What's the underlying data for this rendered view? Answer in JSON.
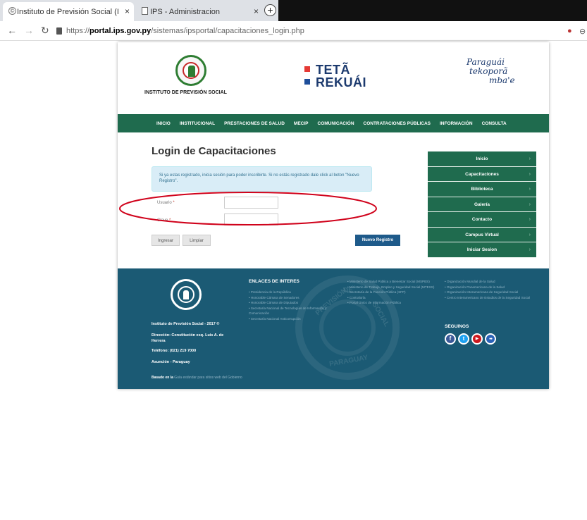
{
  "browser": {
    "tabs": [
      {
        "title": "Instituto de Previsión Social (IPS)",
        "active": true
      },
      {
        "title": "IPS - Administracion",
        "active": false
      }
    ],
    "new_tab": "+",
    "close": "×",
    "url_scheme": "https://",
    "url_host": "portal.ips.gov.py",
    "url_path": "/sistemas/ipsportal/capacitaciones_login.php"
  },
  "header": {
    "logo_text": "INSTITUTO DE PREVISIÓN SOCIAL",
    "teta_line1": "TETÃ",
    "teta_line2": "REKUÁI",
    "slogan": [
      "Paraguái",
      "tekoporã",
      "mba'e"
    ]
  },
  "nav": [
    "INICIO",
    "INSTITUCIONAL",
    "PRESTACIONES DE SALUD",
    "MECIP",
    "COMUNICACIÓN",
    "CONTRATACIONES PÚBLICAS",
    "INFORMACIÓN",
    "CONSULTA"
  ],
  "login": {
    "title": "Login de Capacitaciones",
    "info": "Si ya estas registrado, inicia sesión para poder inscribirte. Si no estás registrado dale click al boton \"Nuevo Registro\".",
    "user_label": "Usuario",
    "pass_label": "Clave",
    "required_mark": " *",
    "user_value": "",
    "pass_value": "",
    "btn_ingresar": "Ingresar",
    "btn_limpiar": "Limpiar",
    "btn_nuevo": "Nuevo Registro"
  },
  "side_menu": [
    "Inicio",
    "Capacitaciones",
    "Biblioteca",
    "Galería",
    "Contacto",
    "Campus Virtual",
    "Iniciar Sesion"
  ],
  "footer": {
    "copyright": "Instituto de Previsión Social - 2017 ©",
    "address": "Dirección: Constitución esq. Luis A. de Herrera",
    "phone": "Teléfono: (021) 219 7000",
    "city": "Asunción - Paraguay",
    "based_label": "Basado en la",
    "based_text": "Guía estándar para sitios web del Gobierno",
    "enlaces_title": "ENLACES DE INTERES",
    "links_col1": [
      "• Presidencia de la República",
      "• Honorable Cámara de Senadores",
      "• Honorable Cámara de Diputados",
      "• Secretaría Nacional de Tecnologías de Información y Comunicación",
      "• Secretaría Nacional Anticorrupción"
    ],
    "links_col2": [
      "• Ministerio de Salud Pública y Bienestar Social (MSPBS)",
      "• Ministerio de Trabajo, Empleo y Seguridad Social (MTESS)",
      "• Secretaría de la Función Pública (SFP)",
      "• Contraloría",
      "• Portal Único de Información Pública"
    ],
    "links_col3": [
      "• Organización Mundial de la Salud",
      "• Organización Panamericana de la Salud",
      "• Organización Interamericana de Seguridad Social",
      "• Centro Interamericano de Estudios de la Seguridad Social"
    ],
    "seguinos": "SEGUINOS",
    "social": [
      "f",
      "t",
      "▶",
      "●●"
    ],
    "watermark_words": [
      "DE",
      "PREVISIÓN",
      "SOCIAL",
      "PARAGUAY"
    ]
  }
}
